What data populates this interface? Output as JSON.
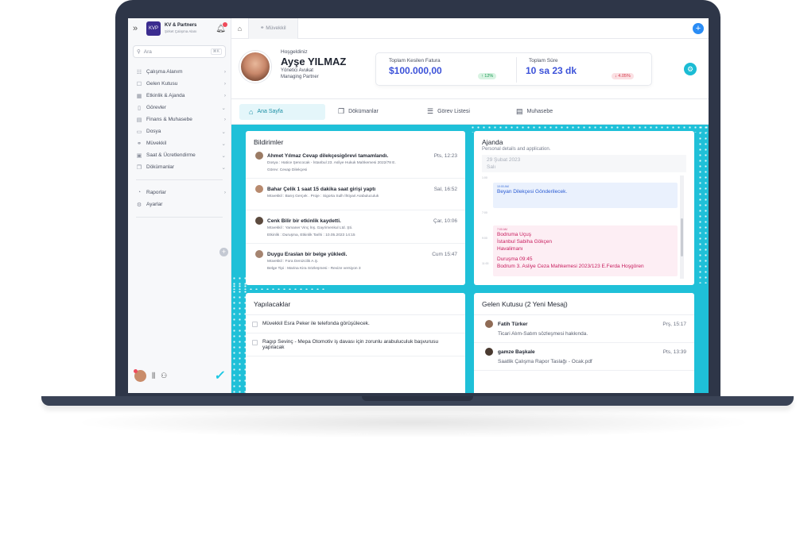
{
  "sidebar": {
    "brand": {
      "name": "KV & Partners",
      "sub": "Şirket Çalışma Alanı",
      "logo_text": "KVP"
    },
    "search": {
      "placeholder": "Ara",
      "shortcut": "⌘K"
    },
    "items": [
      {
        "label": "Çalışma Alanım",
        "chevron": "›"
      },
      {
        "label": "Gelen Kutusu",
        "chevron": "›"
      },
      {
        "label": "Etkinlik & Ajanda",
        "chevron": "›"
      },
      {
        "label": "Görevler",
        "chevron": "⌄"
      },
      {
        "label": "Finans & Muhasebe",
        "chevron": "›"
      },
      {
        "label": "Dosya",
        "chevron": "⌄"
      },
      {
        "label": "Müvekkil",
        "chevron": "⌄"
      },
      {
        "label": "Saat & Ücretlendirme",
        "chevron": "⌄"
      },
      {
        "label": "Dökümanlar",
        "chevron": "⌄"
      }
    ],
    "items2": [
      {
        "label": "Raporlar",
        "chevron": "›"
      },
      {
        "label": "Ayarlar",
        "chevron": ""
      }
    ]
  },
  "tabs": {
    "client_tab": "Müvekkil"
  },
  "header": {
    "greeting": "Hoşgeldiniz",
    "name": "Ayşe YILMAZ",
    "role1": "Yönetici Avukat",
    "role2": "Managing Partner",
    "stat1": {
      "label": "Toplam Kesilen Fatura",
      "value": "$100.000,00",
      "change": "↑ 12%"
    },
    "stat2": {
      "label": "Toplam Süre",
      "value": "10 sa 23 dk",
      "change": "↓ 4.05%"
    }
  },
  "subtabs": [
    {
      "label": "Ana Sayfa",
      "icon": "⌂"
    },
    {
      "label": "Dökümanlar",
      "icon": "❐"
    },
    {
      "label": "Görev Listesi",
      "icon": "☰"
    },
    {
      "label": "Muhasebe",
      "icon": "▤"
    }
  ],
  "notifications": {
    "title": "Bildirimler",
    "items": [
      {
        "title": "Ahmet Yılmaz Cevap dilekçesigörevi tamamlandı.",
        "time": "Pts, 12:23",
        "line1": "Dosya : Hatice Şencocak - İstanbul 23. Asliye Hukuk Mahkemesi 2022/78 E.",
        "line2": "Görev: Cevap Dilekçesi"
      },
      {
        "title": "Bahar Çelik 1 saat 15 dakika saat girişi yaptı",
        "time": "Sal, 16:52",
        "line1": "Müvekkil : Barış Gerçek . Proje : Sigorta Sulh İhtiyari Arabuluculuk",
        "line2": ""
      },
      {
        "title": "Cenk Bilir bir etkinlik kaydetti.",
        "time": "Çar, 10:06",
        "line1": "Müvekkil : Yamaner Vinç İnş. Gayrimenkul Ltd. Şti.",
        "line2": "Etkinlik : Duruşma, Etkinlik Tarihi : 10.05.2023 14:15"
      },
      {
        "title": "Duygu Eraslan bir belge yükledi.",
        "time": "Cum 15:47",
        "line1": "Müvekkil : Fora Denizcilik A.Ş.",
        "line2": "Belge Tipi : Marina Kira Sözleşmesi - Revize versiyon 3"
      }
    ]
  },
  "agenda": {
    "title": "Ajanda",
    "subtitle": "Personal details and application.",
    "date": "29 Şubat 2023",
    "day": "Salı",
    "hours": [
      "1:00",
      "7:00",
      "9:00",
      "11:00"
    ],
    "event1": {
      "time": "10:00 AM",
      "text": "Beyan Dilekçesi Gönderilecek."
    },
    "event2": {
      "time": "7:00 AM",
      "lines": [
        "Bodruma Uçuş",
        "İstanbul Sabiha Gökçen",
        "Havalimanı",
        "",
        "Duruşma 09:45",
        "Bodrum 3. Asliye Ceza Mahkemesi 2023/123 E.Ferda Hoşgören"
      ]
    }
  },
  "todos": {
    "title": "Yapılacaklar",
    "items": [
      "Müvekkil Esra Peker ile telefonda görüşülecek.",
      "Ragıp Sevinç - Mepa Otomotiv iş davası için zorunlu arabuluculuk başvurusu yapılacak"
    ]
  },
  "inbox": {
    "title": "Gelen Kutusu (2 Yeni Mesaj)",
    "items": [
      {
        "name": "Fatih Türker",
        "time": "Prş, 15:17",
        "text": "Ticari Alım-Satım sözleşmesi hakkında."
      },
      {
        "name": "gamze Başkale",
        "time": "Pts, 13:39",
        "text": "Saatlik Çalışma Rapor Taslağı - Ocak.pdf"
      }
    ]
  },
  "colors": {
    "accent": "#1fc0d8",
    "primary": "#3c52d9",
    "success": "#1c9a55",
    "danger": "#d43b4c",
    "event_pink": "#c81d5e"
  }
}
